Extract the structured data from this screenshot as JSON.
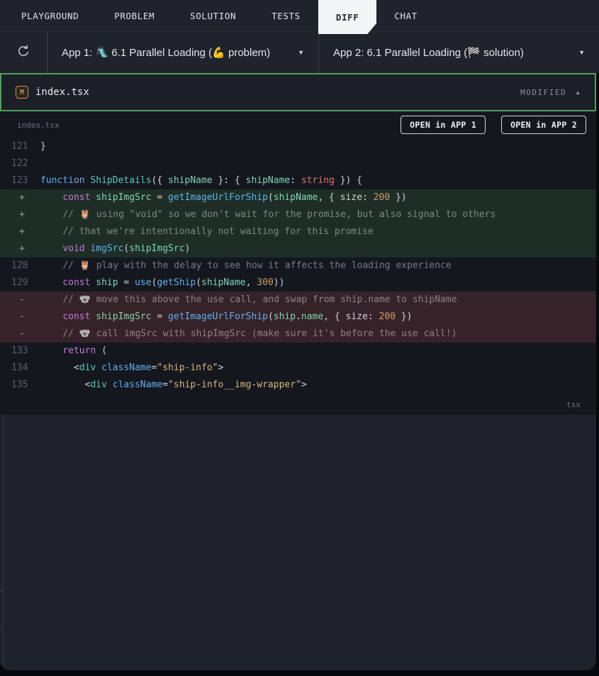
{
  "tabs": {
    "items": [
      {
        "label": "PLAYGROUND",
        "active": false
      },
      {
        "label": "PROBLEM",
        "active": false
      },
      {
        "label": "SOLUTION",
        "active": false
      },
      {
        "label": "TESTS",
        "active": false
      },
      {
        "label": "DIFF",
        "active": true
      },
      {
        "label": "CHAT",
        "active": false
      }
    ]
  },
  "toolbar": {
    "refresh_icon": "refresh-circular-arrow",
    "app1_label": "App 1: 🛝 6.1 Parallel Loading (💪 problem)",
    "app2_label": "App 2: 6.1 Parallel Loading (🏁 solution)",
    "caret_icon": "▼"
  },
  "file_header": {
    "badge": "M",
    "filename": "index.tsx",
    "status": "MODIFIED",
    "collapse_icon": "▲"
  },
  "code_panel": {
    "filename_label": "index.tsx",
    "open_app1": "OPEN in APP 1",
    "open_app2": "OPEN in APP 2",
    "lang_label": "tsx",
    "lines": [
      {
        "num": "121",
        "type": "ctx",
        "tokens": [
          {
            "t": "}",
            "c": "d"
          }
        ]
      },
      {
        "num": "122",
        "type": "ctx",
        "tokens": []
      },
      {
        "num": "123",
        "type": "ctx",
        "tokens": [
          {
            "t": "function",
            "c": "b"
          },
          {
            "t": " ",
            "c": "d"
          },
          {
            "t": "ShipDetails",
            "c": "t"
          },
          {
            "t": "({ ",
            "c": "d"
          },
          {
            "t": "shipName",
            "c": "v"
          },
          {
            "t": " }: { ",
            "c": "d"
          },
          {
            "t": "shipName",
            "c": "v"
          },
          {
            "t": ": ",
            "c": "d"
          },
          {
            "t": "string",
            "c": "ty"
          },
          {
            "t": " }) {",
            "c": "d"
          }
        ]
      },
      {
        "sign": "+",
        "type": "add",
        "tokens": [
          {
            "t": "    ",
            "c": "d"
          },
          {
            "t": "const",
            "c": "k"
          },
          {
            "t": " ",
            "c": "d"
          },
          {
            "t": "shipImgSrc",
            "c": "v"
          },
          {
            "t": " = ",
            "c": "d"
          },
          {
            "t": "getImageUrlForShip",
            "c": "b"
          },
          {
            "t": "(",
            "c": "d"
          },
          {
            "t": "shipName",
            "c": "v"
          },
          {
            "t": ", { size: ",
            "c": "d"
          },
          {
            "t": "200",
            "c": "n"
          },
          {
            "t": " })",
            "c": "d"
          }
        ]
      },
      {
        "sign": "+",
        "type": "add",
        "tokens": [
          {
            "t": "    ",
            "c": "d"
          },
          {
            "t": "// 🦉 using \"void\" so we don't wait for the promise, but also signal to others",
            "c": "c"
          }
        ]
      },
      {
        "sign": "+",
        "type": "add",
        "tokens": [
          {
            "t": "    ",
            "c": "d"
          },
          {
            "t": "// that we're intentionally not waiting for this promise",
            "c": "c"
          }
        ]
      },
      {
        "sign": "+",
        "type": "add",
        "tokens": [
          {
            "t": "    ",
            "c": "d"
          },
          {
            "t": "void",
            "c": "k"
          },
          {
            "t": " ",
            "c": "d"
          },
          {
            "t": "imgSrc",
            "c": "b"
          },
          {
            "t": "(",
            "c": "d"
          },
          {
            "t": "shipImgSrc",
            "c": "v"
          },
          {
            "t": ")",
            "c": "d"
          }
        ]
      },
      {
        "num": "128",
        "type": "ctx",
        "tokens": [
          {
            "t": "    ",
            "c": "d"
          },
          {
            "t": "// 🦉 play with the delay to see how it affects the loading experience",
            "c": "c"
          }
        ]
      },
      {
        "num": "129",
        "type": "ctx",
        "tokens": [
          {
            "t": "    ",
            "c": "d"
          },
          {
            "t": "const",
            "c": "k"
          },
          {
            "t": " ",
            "c": "d"
          },
          {
            "t": "ship",
            "c": "v"
          },
          {
            "t": " = ",
            "c": "d"
          },
          {
            "t": "use",
            "c": "b"
          },
          {
            "t": "(",
            "c": "d"
          },
          {
            "t": "getShip",
            "c": "b"
          },
          {
            "t": "(",
            "c": "d"
          },
          {
            "t": "shipName",
            "c": "v"
          },
          {
            "t": ", ",
            "c": "d"
          },
          {
            "t": "300",
            "c": "n"
          },
          {
            "t": "))",
            "c": "d"
          }
        ]
      },
      {
        "sign": "-",
        "type": "del",
        "tokens": [
          {
            "t": "    ",
            "c": "d"
          },
          {
            "t": "// 🐨 move this above the use call, and swap from ship.name to shipName",
            "c": "c"
          }
        ]
      },
      {
        "sign": "-",
        "type": "del",
        "tokens": [
          {
            "t": "    ",
            "c": "d"
          },
          {
            "t": "const",
            "c": "k"
          },
          {
            "t": " ",
            "c": "d"
          },
          {
            "t": "shipImgSrc",
            "c": "v"
          },
          {
            "t": " = ",
            "c": "d"
          },
          {
            "t": "getImageUrlForShip",
            "c": "b"
          },
          {
            "t": "(",
            "c": "d"
          },
          {
            "t": "ship",
            "c": "v"
          },
          {
            "t": ".",
            "c": "d"
          },
          {
            "t": "name",
            "c": "v"
          },
          {
            "t": ", { size: ",
            "c": "d"
          },
          {
            "t": "200",
            "c": "n"
          },
          {
            "t": " })",
            "c": "d"
          }
        ]
      },
      {
        "sign": "-",
        "type": "del",
        "tokens": [
          {
            "t": "    ",
            "c": "d"
          },
          {
            "t": "// 🐨 call imgSrc with shipImgSrc (make sure it's before the use call!)",
            "c": "c"
          }
        ]
      },
      {
        "num": "133",
        "type": "ctx",
        "tokens": [
          {
            "t": "    ",
            "c": "d"
          },
          {
            "t": "return",
            "c": "k"
          },
          {
            "t": " (",
            "c": "d"
          }
        ]
      },
      {
        "num": "134",
        "type": "ctx",
        "tokens": [
          {
            "t": "      <",
            "c": "d"
          },
          {
            "t": "div",
            "c": "t"
          },
          {
            "t": " ",
            "c": "d"
          },
          {
            "t": "className",
            "c": "b"
          },
          {
            "t": "=",
            "c": "d"
          },
          {
            "t": "\"",
            "c": "q"
          },
          {
            "t": "ship-info",
            "c": "s"
          },
          {
            "t": "\"",
            "c": "q"
          },
          {
            "t": ">",
            "c": "d"
          }
        ]
      },
      {
        "num": "135",
        "type": "ctx",
        "tokens": [
          {
            "t": "        <",
            "c": "d"
          },
          {
            "t": "div",
            "c": "t"
          },
          {
            "t": " ",
            "c": "d"
          },
          {
            "t": "className",
            "c": "b"
          },
          {
            "t": "=",
            "c": "d"
          },
          {
            "t": "\"",
            "c": "q"
          },
          {
            "t": "ship-info__img-wrapper",
            "c": "s"
          },
          {
            "t": "\"",
            "c": "q"
          },
          {
            "t": ">",
            "c": "d"
          }
        ]
      }
    ]
  },
  "colors": {
    "accent_green_border": "#4d9f57",
    "added_line_bg": "#1e2e26",
    "removed_line_bg": "#362329",
    "active_tab_bg": "#f4f5f7",
    "panel_bg": "#1e222b",
    "code_bg": "#14171e",
    "modified_badge_orange": "#d6923f"
  }
}
